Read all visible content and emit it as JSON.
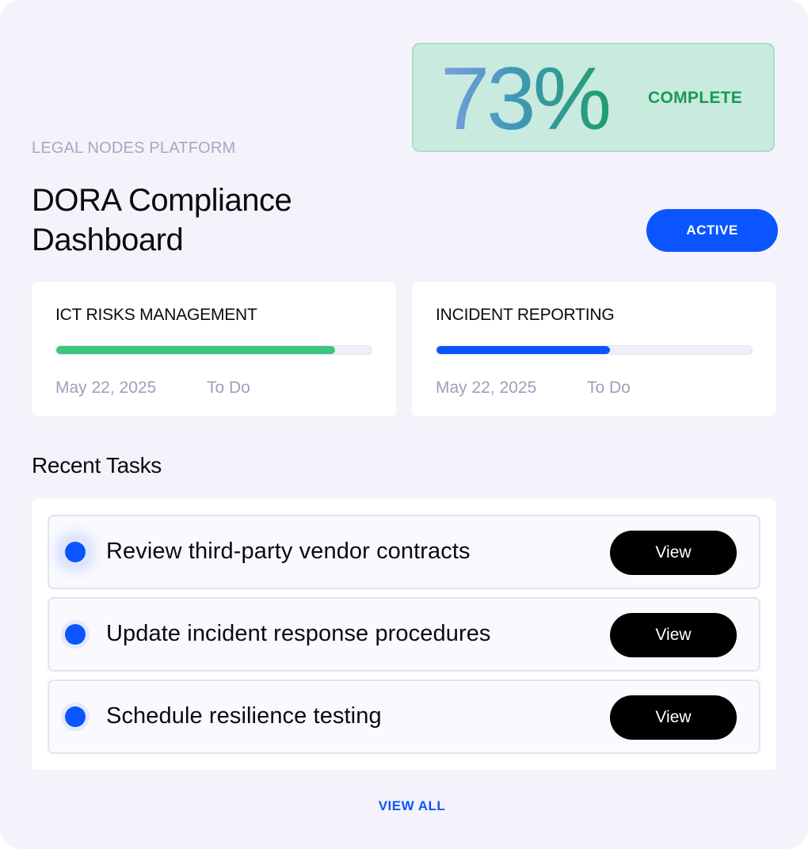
{
  "header": {
    "eyebrow": "LEGAL NODES PLATFORM",
    "title": "DORA Compliance Dashboard",
    "status_badge": "ACTIVE"
  },
  "progress": {
    "value_label": "73%",
    "value": 73,
    "label": "COMPLETE"
  },
  "modules": [
    {
      "title": "ICT RISKS MANAGEMENT",
      "progress": 0.885,
      "bar_color": "#3ac47d",
      "date": "May 22, 2025",
      "status": "To Do"
    },
    {
      "title": "INCIDENT REPORTING",
      "progress": 0.55,
      "bar_color": "#0a55ff",
      "date": "May 22, 2025",
      "status": "To Do"
    }
  ],
  "recent_tasks": {
    "title": "Recent Tasks",
    "items": [
      {
        "label": "Review third-party vendor contracts",
        "button": "View"
      },
      {
        "label": "Update incident response procedures",
        "button": "View"
      },
      {
        "label": "Schedule resilience testing",
        "button": "View"
      }
    ],
    "view_all": "VIEW ALL"
  },
  "colors": {
    "accent": "#0a55ff",
    "success": "#1a9a4f",
    "background": "#f4f3fb"
  },
  "icons": {
    "task_status": "status-dot-icon"
  }
}
